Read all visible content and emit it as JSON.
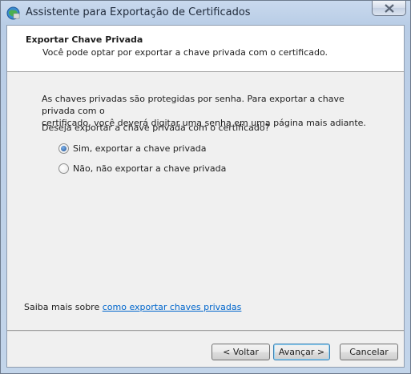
{
  "window": {
    "title": "Assistente para Exportação de Certificados"
  },
  "header": {
    "title": "Exportar Chave Privada",
    "subtitle": "Você pode optar por exportar a chave privada com o certificado."
  },
  "body": {
    "line1": "As chaves privadas são protegidas por senha. Para exportar a chave privada com o",
    "line2": "certificado, você deverá digitar uma senha em uma página mais adiante.",
    "question": "Deseja exportar a chave privada com o certificado?",
    "options": [
      {
        "label": "Sim, exportar a chave privada",
        "selected": true
      },
      {
        "label": "Não, não exportar a chave privada",
        "selected": false
      }
    ]
  },
  "learn_more": {
    "prefix": "Saiba mais sobre ",
    "link": "como exportar chaves privadas"
  },
  "buttons": {
    "back": "< Voltar",
    "next": "Avançar >",
    "cancel": "Cancelar"
  },
  "icons": {
    "app": "certificate-icon",
    "close": "close-icon"
  }
}
